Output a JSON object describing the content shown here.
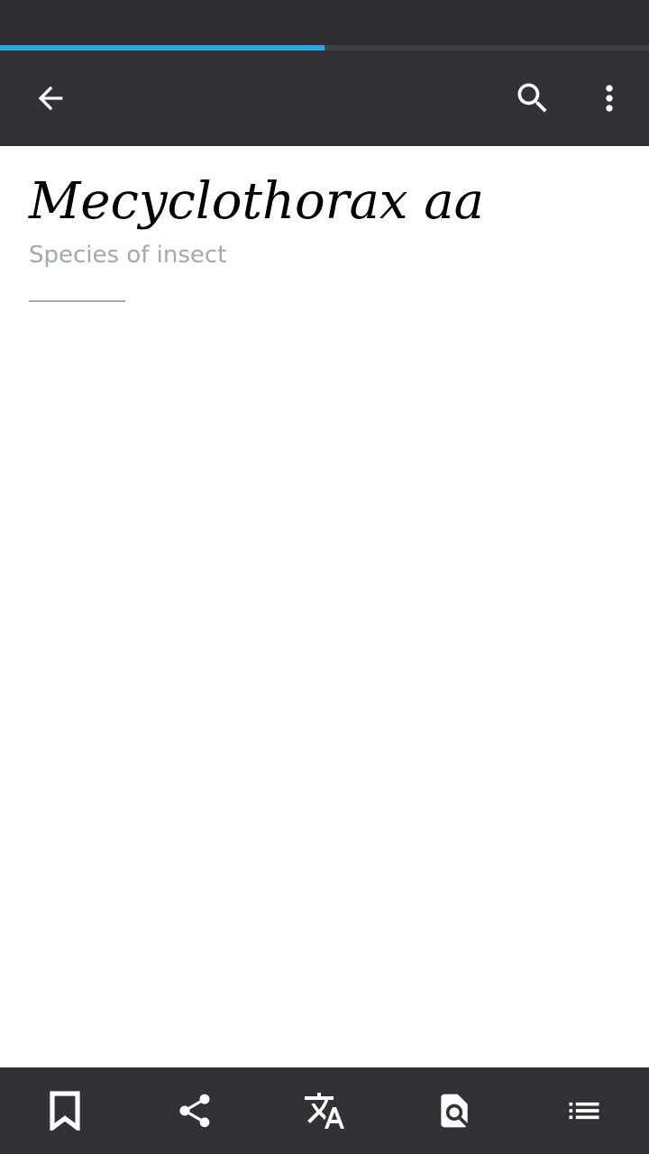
{
  "load_progress": 0.5,
  "colors": {
    "progress": "#2aa7e0",
    "toolbar": "#303236",
    "status_bar": "#2a2c30",
    "description": "#a2a9b1"
  },
  "toolbar": {
    "icons": [
      "back-arrow-icon",
      "search-icon",
      "more-vert-icon"
    ]
  },
  "article": {
    "title": "Mecyclothorax aa",
    "description": "Species of insect"
  },
  "bottom_bar": {
    "icons": [
      "bookmark-icon",
      "share-icon",
      "translate-icon",
      "find-in-page-icon",
      "table-of-contents-icon"
    ]
  }
}
